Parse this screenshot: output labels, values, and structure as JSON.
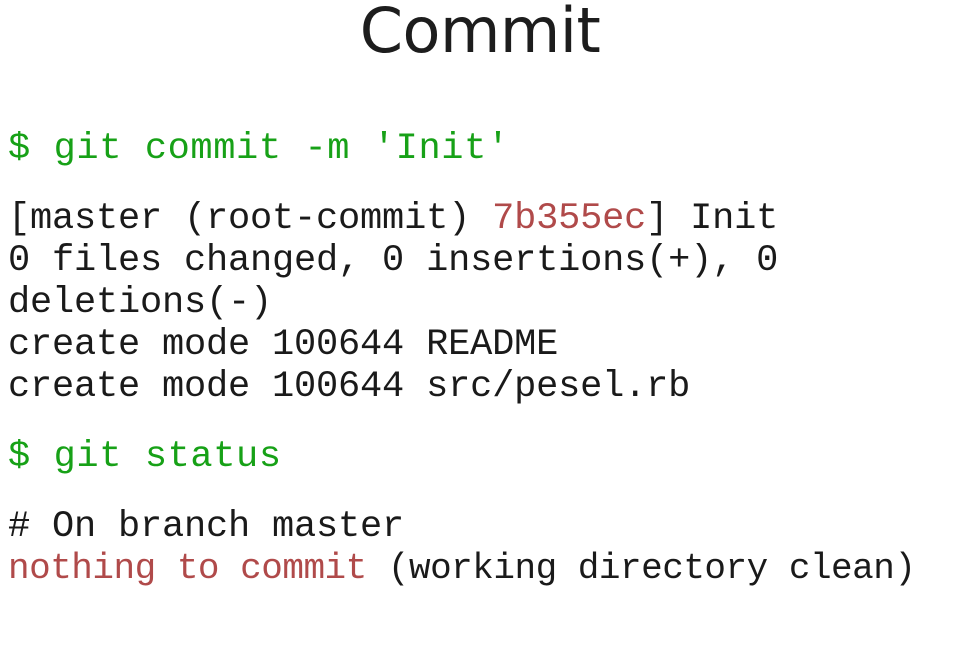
{
  "slide": {
    "title": "Commit",
    "background_color": "#ffffff",
    "text_color": "#1a1a1a",
    "prompt_color": "#17a117",
    "highlight_color": "#b04a4a"
  },
  "terminal": {
    "command_1": "$ git commit -m 'Init'",
    "output_1": {
      "line_1_prefix": "[master (root-commit) ",
      "line_1_hash": "7b355ec",
      "line_1_suffix": "] Init",
      "line_2": "0 files changed, 0 insertions(+), 0",
      "line_3": "deletions(-)",
      "line_4": "create mode 100644 README",
      "line_5": "create mode 100644 src/pesel.rb"
    },
    "command_2": "$ git status",
    "output_2": {
      "line_1": "# On branch master",
      "line_2_warn": "nothing to commit",
      "line_2_rest": " (working directory clean)"
    }
  }
}
